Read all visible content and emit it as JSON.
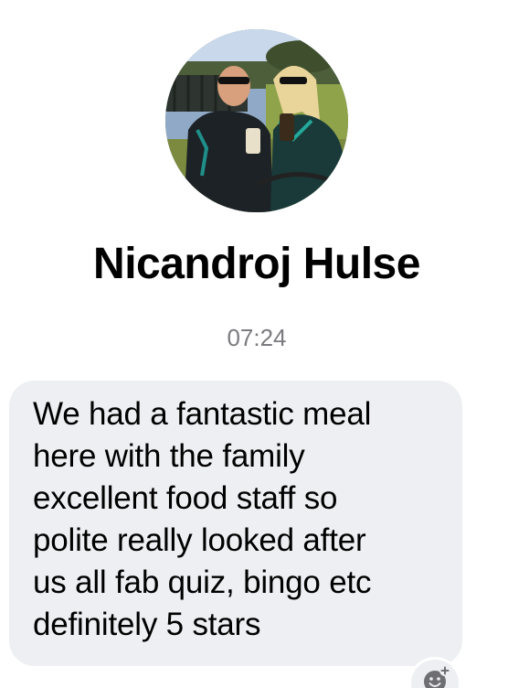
{
  "contact": {
    "name": "Nicandroj Hulse",
    "avatar_icon": "profile-photo"
  },
  "message": {
    "time": "07:24",
    "text": "We had a fantastic meal\nhere with the family\nexcellent food staff so\npolite really looked after\nus all fab quiz, bingo etc\ndefinitely 5 stars"
  },
  "actions": {
    "react_icon": "add-reaction-icon"
  },
  "colors": {
    "bubble": "#eeeff3",
    "timestamp": "#7b7b7f",
    "text": "#000000",
    "background": "#ffffff"
  }
}
